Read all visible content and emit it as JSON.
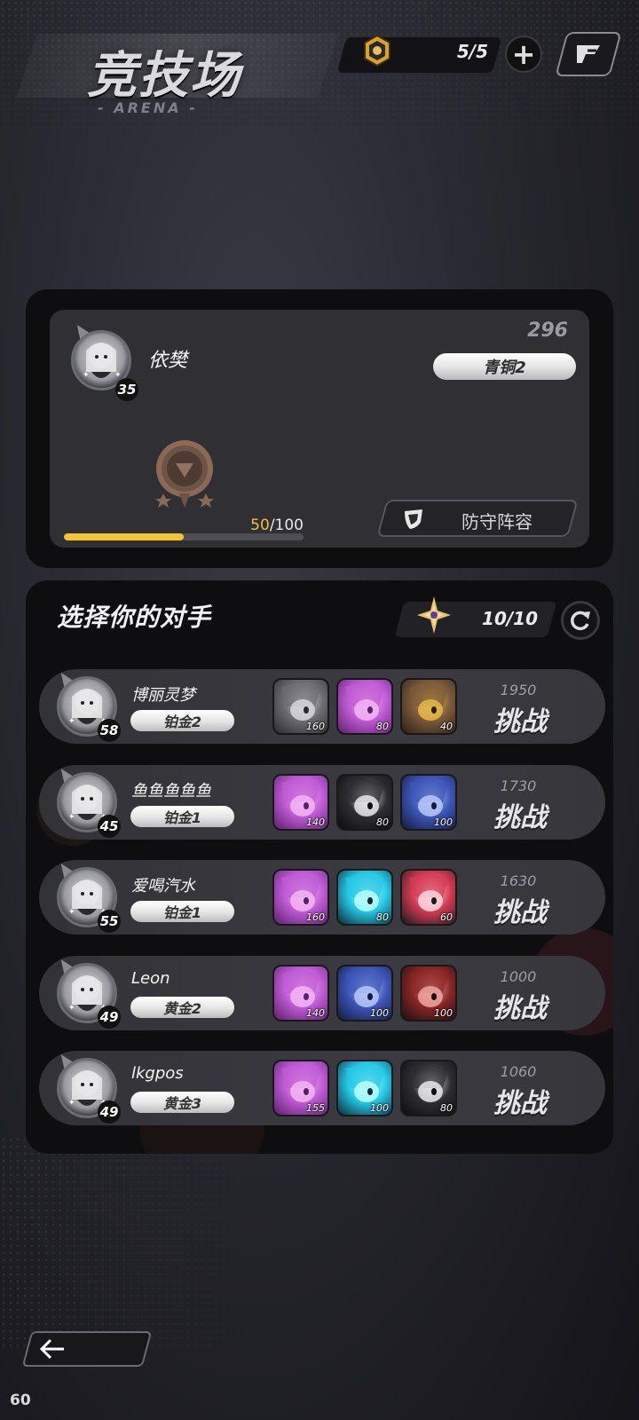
{
  "header": {
    "title": "竞技场",
    "subtitle": "- ARENA -",
    "ticket_count": "5/5"
  },
  "player": {
    "name": "依樊",
    "level": "35",
    "score": "296",
    "tier": "青铜2",
    "progress_current": "50",
    "progress_max": "/100",
    "progress_fraction": 0.5,
    "defense_label": "防守阵容"
  },
  "opponents_section": {
    "title": "选择你的对手",
    "challenges": "10/10",
    "challenge_label": "挑战",
    "rows": [
      {
        "name": "博丽灵梦",
        "level": "58",
        "tier": "铂金2",
        "score": "1950",
        "heroes": [
          {
            "level": "160",
            "color": "gray"
          },
          {
            "level": "80",
            "color": "pink"
          },
          {
            "level": "40",
            "color": "gold"
          }
        ]
      },
      {
        "name": "鱼鱼鱼鱼鱼",
        "level": "45",
        "tier": "铂金1",
        "score": "1730",
        "heroes": [
          {
            "level": "140",
            "color": "pink"
          },
          {
            "level": "80",
            "color": "dark"
          },
          {
            "level": "100",
            "color": "blue"
          }
        ]
      },
      {
        "name": "爱喝汽水",
        "level": "55",
        "tier": "铂金1",
        "score": "1630",
        "heroes": [
          {
            "level": "160",
            "color": "pink"
          },
          {
            "level": "80",
            "color": "cyan"
          },
          {
            "level": "60",
            "color": "red"
          }
        ]
      },
      {
        "name": "Leon",
        "level": "49",
        "tier": "黄金2",
        "score": "1000",
        "heroes": [
          {
            "level": "140",
            "color": "pink"
          },
          {
            "level": "100",
            "color": "blue"
          },
          {
            "level": "100",
            "color": "crimson"
          }
        ]
      },
      {
        "name": "lkgpos",
        "level": "49",
        "tier": "黄金3",
        "score": "1060",
        "heroes": [
          {
            "level": "155",
            "color": "pink"
          },
          {
            "level": "100",
            "color": "cyan"
          },
          {
            "level": "80",
            "color": "dark"
          }
        ]
      }
    ]
  },
  "footer": {
    "fps": "60"
  },
  "colors": {
    "accent_gold": "#f5c531",
    "panel": "#0e0e10",
    "card": "#2f2f34"
  },
  "icons": [
    "arena-ticket-icon",
    "plus-icon",
    "rank-icon",
    "shield-icon",
    "star-ticket-icon",
    "refresh-icon",
    "back-arrow-icon",
    "bronze-medal-icon"
  ]
}
